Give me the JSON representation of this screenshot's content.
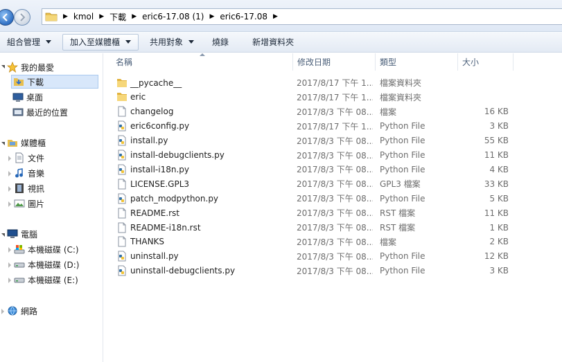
{
  "address": {
    "crumbs": [
      "kmol",
      "下載",
      "eric6-17.08 (1)",
      "eric6-17.08"
    ]
  },
  "toolbar": {
    "organize": "組合管理",
    "add_to_library": "加入至媒體櫃",
    "share_with": "共用對象",
    "burn": "燒錄",
    "new_folder": "新增資料夾"
  },
  "nav": {
    "favorites": "我的最愛",
    "downloads": "下載",
    "desktop": "桌面",
    "recent": "最近的位置",
    "libraries": "媒體櫃",
    "documents": "文件",
    "music": "音樂",
    "videos": "視訊",
    "pictures": "圖片",
    "computer": "電腦",
    "drive_c": "本機磁碟 (C:)",
    "drive_d": "本機磁碟 (D:)",
    "drive_e": "本機磁碟 (E:)",
    "network": "網路"
  },
  "columns": {
    "name": "名稱",
    "date": "修改日期",
    "type": "類型",
    "size": "大小"
  },
  "files": [
    {
      "name": "__pycache__",
      "date": "2017/8/17 下午 1...",
      "type": "檔案資料夾",
      "size": "",
      "icon": "folder"
    },
    {
      "name": "eric",
      "date": "2017/8/17 下午 1...",
      "type": "檔案資料夾",
      "size": "",
      "icon": "folder"
    },
    {
      "name": "changelog",
      "date": "2017/8/3 下午 08...",
      "type": "檔案",
      "size": "16 KB",
      "icon": "file"
    },
    {
      "name": "eric6config.py",
      "date": "2017/8/17 下午 1...",
      "type": "Python File",
      "size": "3 KB",
      "icon": "python"
    },
    {
      "name": "install.py",
      "date": "2017/8/3 下午 08...",
      "type": "Python File",
      "size": "55 KB",
      "icon": "python"
    },
    {
      "name": "install-debugclients.py",
      "date": "2017/8/3 下午 08...",
      "type": "Python File",
      "size": "11 KB",
      "icon": "python"
    },
    {
      "name": "install-i18n.py",
      "date": "2017/8/3 下午 08...",
      "type": "Python File",
      "size": "4 KB",
      "icon": "python"
    },
    {
      "name": "LICENSE.GPL3",
      "date": "2017/8/3 下午 08...",
      "type": "GPL3 檔案",
      "size": "33 KB",
      "icon": "file"
    },
    {
      "name": "patch_modpython.py",
      "date": "2017/8/3 下午 08...",
      "type": "Python File",
      "size": "5 KB",
      "icon": "python"
    },
    {
      "name": "README.rst",
      "date": "2017/8/3 下午 08...",
      "type": "RST 檔案",
      "size": "11 KB",
      "icon": "file"
    },
    {
      "name": "README-i18n.rst",
      "date": "2017/8/3 下午 08...",
      "type": "RST 檔案",
      "size": "1 KB",
      "icon": "file"
    },
    {
      "name": "THANKS",
      "date": "2017/8/3 下午 08...",
      "type": "檔案",
      "size": "2 KB",
      "icon": "file"
    },
    {
      "name": "uninstall.py",
      "date": "2017/8/3 下午 08...",
      "type": "Python File",
      "size": "12 KB",
      "icon": "python"
    },
    {
      "name": "uninstall-debugclients.py",
      "date": "2017/8/3 下午 08...",
      "type": "Python File",
      "size": "3 KB",
      "icon": "python"
    }
  ]
}
